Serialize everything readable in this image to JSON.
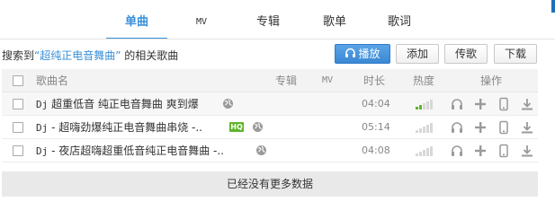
{
  "tabs": [
    {
      "label": "单曲",
      "active": true
    },
    {
      "label": "MV",
      "active": false
    },
    {
      "label": "专辑",
      "active": false
    },
    {
      "label": "歌单",
      "active": false
    },
    {
      "label": "歌词",
      "active": false
    }
  ],
  "result": {
    "prefix": "搜索到",
    "keyword": "“超纯正电音舞曲”",
    "suffix": "的相关歌曲"
  },
  "toolbar": {
    "play_label": "播放",
    "add_label": "添加",
    "share_label": "传歌",
    "download_label": "下载"
  },
  "table": {
    "headers": {
      "name": "歌曲名",
      "album": "专辑",
      "mv": "MV",
      "duration": "时长",
      "popularity": "热度",
      "actions": "操作"
    },
    "rows": [
      {
        "prefix": "Dj",
        "title": "超重低音 纯正电音舞曲 爽到爆",
        "duration": "04:04",
        "hq": false,
        "popularity": 0.4
      },
      {
        "prefix": "Dj",
        "title": "- 超嗨劲爆纯正电音舞曲串烧 -..",
        "duration": "05:14",
        "hq": true,
        "hq_label": "HQ",
        "popularity": 0.0
      },
      {
        "prefix": "Dj",
        "title": "- 夜店超嗨超重低音纯正电音舞曲 -..",
        "duration": "04:08",
        "hq": false,
        "popularity": 0.0
      }
    ]
  },
  "footer": {
    "no_more": "已经没有更多数据"
  },
  "colors": {
    "accent": "#3a8fd8",
    "hq_badge": "#61b52d",
    "popularity_on": "#61b52d",
    "popularity_off": "#d8d8d8"
  },
  "icons": [
    "headphones-icon",
    "globe-icon",
    "plus-icon",
    "phone-icon",
    "download-icon"
  ]
}
